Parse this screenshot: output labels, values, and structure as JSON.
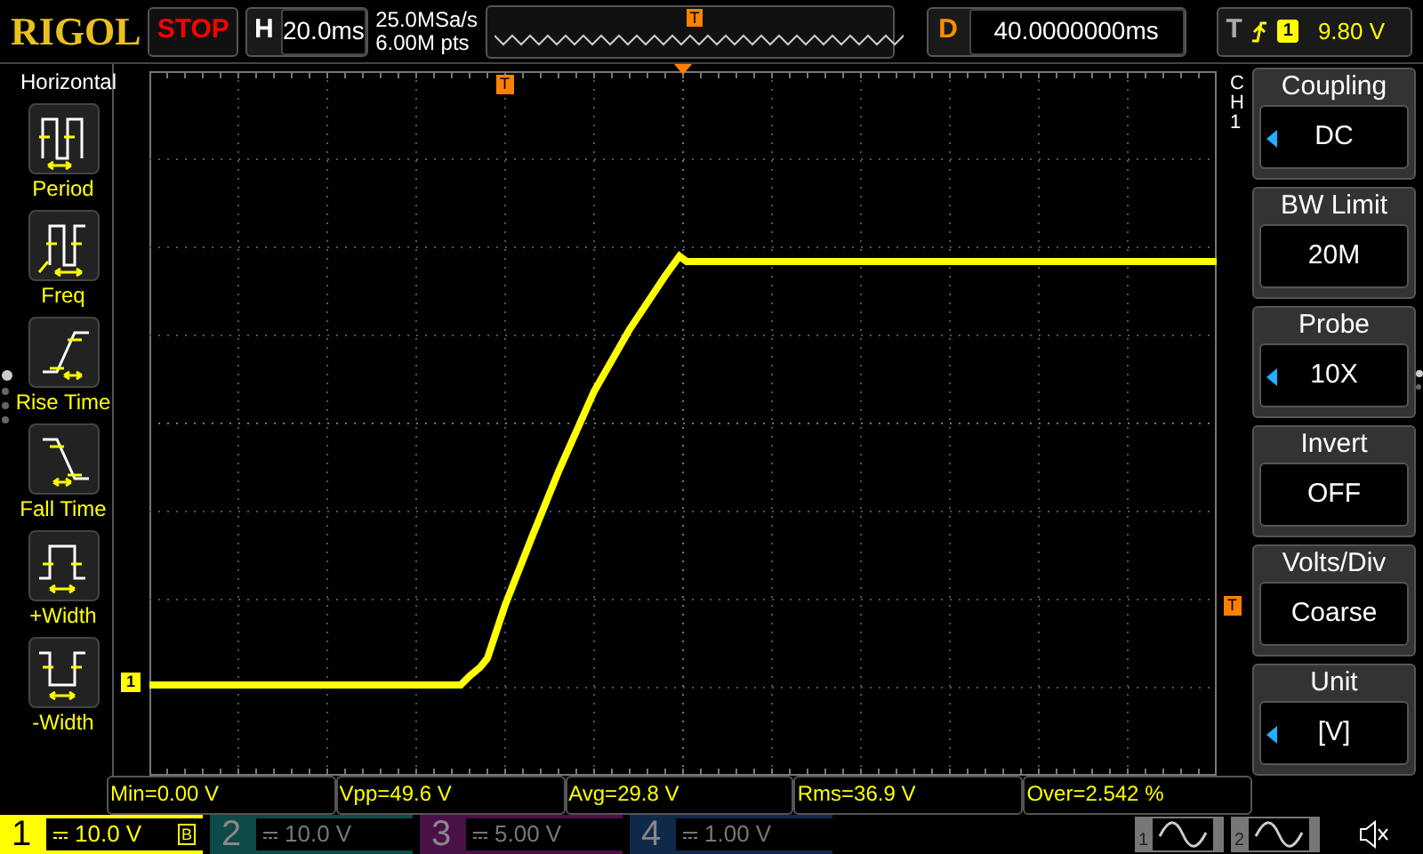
{
  "top_bar": {
    "logo": "RIGOL",
    "run_state": "STOP",
    "timebase": {
      "label": "H",
      "value": "20.0ms"
    },
    "sample_rate": "25.0MSa/s",
    "memory_depth": "6.00M pts",
    "overview_marker": "T",
    "delay": {
      "label": "D",
      "value": "40.0000000ms"
    },
    "trigger": {
      "label": "T",
      "source": "1",
      "level": "9.80 V"
    }
  },
  "measure_menu": {
    "title": "Horizontal",
    "items": [
      {
        "label": "Period",
        "kind": "period"
      },
      {
        "label": "Freq",
        "kind": "freq"
      },
      {
        "label": "Rise Time",
        "kind": "rise"
      },
      {
        "label": "Fall Time",
        "kind": "fall"
      },
      {
        "label": "+Width",
        "kind": "pwidth"
      },
      {
        "label": "-Width",
        "kind": "nwidth"
      }
    ],
    "pages": [
      {
        "selected": true
      },
      {
        "selected": false
      },
      {
        "selected": false
      },
      {
        "selected": false
      }
    ]
  },
  "screen": {
    "channel_marker": "1",
    "trigger_position_marker": "T",
    "trigger_level_marker": "T"
  },
  "channel_menu": {
    "channel": "CH1",
    "items": [
      {
        "title": "Coupling",
        "value": "DC",
        "adjustable": true
      },
      {
        "title": "BW Limit",
        "value": "20M",
        "adjustable": false
      },
      {
        "title": "Probe",
        "value": "10X",
        "adjustable": true
      },
      {
        "title": "Invert",
        "value": "OFF",
        "adjustable": false
      },
      {
        "title": "Volts/Div",
        "value": "Coarse",
        "adjustable": false
      },
      {
        "title": "Unit",
        "value": "[V]",
        "adjustable": true
      }
    ],
    "pages": [
      {
        "selected": true
      },
      {
        "selected": false
      }
    ]
  },
  "measurements": [
    "Min=0.00 V",
    "Vpp=49.6 V",
    "Avg=29.8 V",
    "Rms=36.9 V",
    "Over=2.542 %"
  ],
  "channels": [
    {
      "number": "1",
      "scale": "10.0 V",
      "on": true,
      "color": "#ffff00",
      "badge": "B"
    },
    {
      "number": "2",
      "scale": "10.0 V",
      "on": false,
      "color": "#0e4a48"
    },
    {
      "number": "3",
      "scale": "5.00 V",
      "on": false,
      "color": "#4a1048"
    },
    {
      "number": "4",
      "scale": "1.00 V",
      "on": false,
      "color": "#10284a"
    }
  ],
  "generators": [
    {
      "number": "1"
    },
    {
      "number": "2"
    }
  ]
}
